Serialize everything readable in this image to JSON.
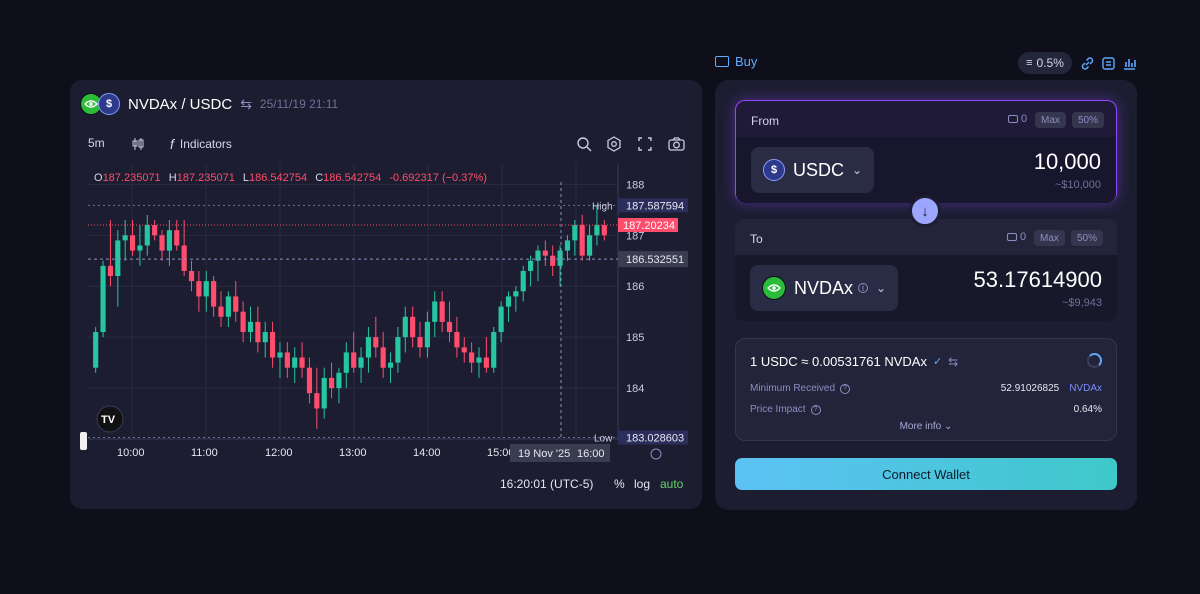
{
  "chart": {
    "pair": "NVDAx / USDC",
    "datetime": "25/11/19 21:11",
    "interval": "5m",
    "indicators_label": "Indicators",
    "ohlc": {
      "o_label": "O",
      "o": "187.235071",
      "h_label": "H",
      "h": "187.235071",
      "l_label": "L",
      "l": "186.542754",
      "c_label": "C",
      "c": "186.542754",
      "change": "-0.692317 (−0.37%)"
    },
    "y_ticks": [
      "188",
      "187",
      "186",
      "185",
      "184"
    ],
    "x_ticks": [
      "10:00",
      "11:00",
      "12:00",
      "13:00",
      "14:00",
      "15:00",
      "16:00"
    ],
    "high_label": "High",
    "high_value": "187.587594",
    "low_label": "Low",
    "low_value": "183.028603",
    "current_price": "187.20234",
    "crosshair_price": "186.532551",
    "crosshair_date": "19 Nov '25",
    "crosshair_time": "16:00",
    "clock": "16:20:01 (UTC-5)",
    "scale_pct": "%",
    "scale_log": "log",
    "scale_auto": "auto",
    "watermark": "TV",
    "colors": {
      "up": "#26c6a0",
      "down": "#ff4d6d",
      "bg": "#1c1d30"
    }
  },
  "header": {
    "buy_label": "Buy",
    "slippage": "0.5%",
    "icons": [
      "sliders-icon",
      "link-icon",
      "route-icon",
      "bar-chart-icon"
    ]
  },
  "swap": {
    "from": {
      "label": "From",
      "balance": "0",
      "max": "Max",
      "half": "50%",
      "token": "USDC",
      "amount": "10,000",
      "usd": "~$10,000"
    },
    "to": {
      "label": "To",
      "balance": "0",
      "max": "Max",
      "half": "50%",
      "token": "NVDAx",
      "amount": "53.17614900",
      "usd": "~$9,943"
    },
    "rate": "1 USDC ≈ 0.00531761 NVDAx",
    "min_received_label": "Minimum Received",
    "min_received_value": "52.91026825",
    "min_received_unit": "NVDAx",
    "price_impact_label": "Price Impact",
    "price_impact_value": "0.64%",
    "more_info": "More info",
    "connect": "Connect Wallet"
  },
  "chart_data": {
    "type": "candlestick",
    "yrange": [
      183,
      188.4
    ],
    "candles": [
      [
        184.4,
        185.2,
        184.3,
        185.1
      ],
      [
        185.1,
        186.5,
        185.0,
        186.4
      ],
      [
        186.4,
        187.3,
        186.0,
        186.2
      ],
      [
        186.2,
        187.1,
        185.6,
        186.9
      ],
      [
        186.9,
        187.3,
        186.5,
        187.0
      ],
      [
        187.0,
        187.3,
        186.6,
        186.7
      ],
      [
        186.7,
        187.2,
        186.4,
        186.8
      ],
      [
        186.8,
        187.4,
        186.6,
        187.2
      ],
      [
        187.2,
        187.3,
        186.9,
        187.0
      ],
      [
        187.0,
        187.1,
        186.5,
        186.7
      ],
      [
        186.7,
        187.3,
        186.4,
        187.1
      ],
      [
        187.1,
        187.3,
        186.7,
        186.8
      ],
      [
        186.8,
        187.3,
        186.2,
        186.3
      ],
      [
        186.3,
        186.5,
        185.9,
        186.1
      ],
      [
        186.1,
        186.3,
        185.5,
        185.8
      ],
      [
        185.8,
        186.3,
        185.5,
        186.1
      ],
      [
        186.1,
        186.2,
        185.4,
        185.6
      ],
      [
        185.6,
        185.9,
        185.2,
        185.4
      ],
      [
        185.4,
        185.9,
        185.2,
        185.8
      ],
      [
        185.8,
        186.1,
        185.3,
        185.5
      ],
      [
        185.5,
        185.7,
        184.9,
        185.1
      ],
      [
        185.1,
        185.6,
        184.9,
        185.3
      ],
      [
        185.3,
        185.6,
        184.7,
        184.9
      ],
      [
        184.9,
        185.3,
        184.6,
        185.1
      ],
      [
        185.1,
        185.3,
        184.4,
        184.6
      ],
      [
        184.6,
        184.9,
        184.2,
        184.7
      ],
      [
        184.7,
        184.9,
        184.2,
        184.4
      ],
      [
        184.4,
        184.8,
        184.1,
        184.6
      ],
      [
        184.6,
        184.9,
        184.2,
        184.4
      ],
      [
        184.4,
        184.6,
        183.7,
        183.9
      ],
      [
        183.9,
        184.4,
        183.2,
        183.6
      ],
      [
        183.6,
        184.4,
        183.4,
        184.2
      ],
      [
        184.2,
        184.5,
        183.8,
        184.0
      ],
      [
        184.0,
        184.4,
        183.7,
        184.3
      ],
      [
        184.3,
        184.9,
        184.0,
        184.7
      ],
      [
        184.7,
        185.1,
        184.3,
        184.4
      ],
      [
        184.4,
        184.8,
        184.1,
        184.6
      ],
      [
        184.6,
        185.2,
        184.3,
        185.0
      ],
      [
        185.0,
        185.4,
        184.6,
        184.8
      ],
      [
        184.8,
        185.1,
        184.2,
        184.4
      ],
      [
        184.4,
        184.7,
        184.1,
        184.5
      ],
      [
        184.5,
        185.2,
        184.3,
        185.0
      ],
      [
        185.0,
        185.6,
        184.7,
        185.4
      ],
      [
        185.4,
        185.6,
        184.8,
        185.0
      ],
      [
        185.0,
        185.3,
        184.6,
        184.8
      ],
      [
        184.8,
        185.5,
        184.6,
        185.3
      ],
      [
        185.3,
        185.9,
        185.0,
        185.7
      ],
      [
        185.7,
        185.9,
        185.1,
        185.3
      ],
      [
        185.3,
        185.7,
        184.9,
        185.1
      ],
      [
        185.1,
        185.4,
        184.6,
        184.8
      ],
      [
        184.8,
        185.0,
        184.5,
        184.7
      ],
      [
        184.7,
        184.9,
        184.3,
        184.5
      ],
      [
        184.5,
        184.8,
        184.2,
        184.6
      ],
      [
        184.6,
        185.0,
        184.3,
        184.4
      ],
      [
        184.4,
        185.2,
        184.3,
        185.1
      ],
      [
        185.1,
        185.7,
        184.9,
        185.6
      ],
      [
        185.6,
        185.9,
        185.3,
        185.8
      ],
      [
        185.8,
        186.0,
        185.5,
        185.9
      ],
      [
        185.9,
        186.4,
        185.7,
        186.3
      ],
      [
        186.3,
        186.6,
        186.0,
        186.5
      ],
      [
        186.5,
        186.8,
        186.1,
        186.7
      ],
      [
        186.7,
        186.9,
        186.4,
        186.6
      ],
      [
        186.6,
        186.8,
        186.2,
        186.4
      ],
      [
        186.4,
        186.8,
        186.0,
        186.7
      ],
      [
        186.7,
        187.0,
        186.5,
        186.9
      ],
      [
        186.9,
        187.3,
        186.6,
        187.2
      ],
      [
        187.2,
        187.4,
        186.5,
        186.6
      ],
      [
        186.6,
        187.2,
        186.5,
        187.0
      ],
      [
        187.0,
        187.6,
        186.8,
        187.2
      ],
      [
        187.2,
        187.3,
        186.9,
        187.0
      ]
    ]
  }
}
